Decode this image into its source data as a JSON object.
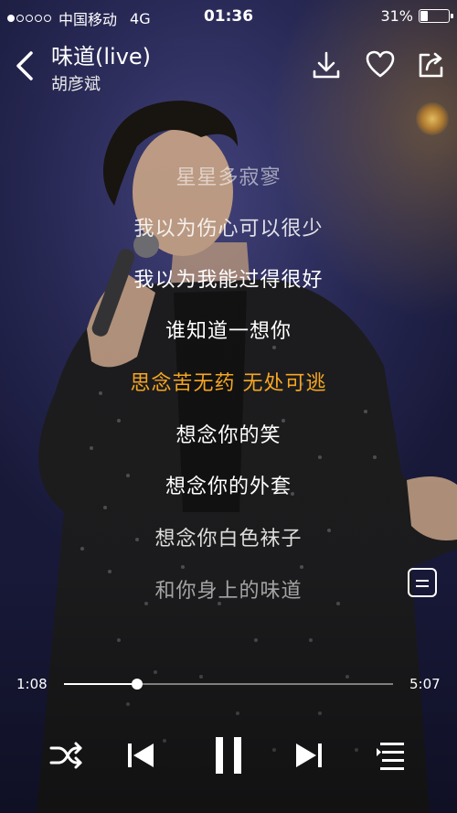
{
  "status_bar": {
    "carrier": "中国移动",
    "network": "4G",
    "time": "01:36",
    "battery_text": "31%",
    "battery_level": 0.31,
    "signal_dots_filled": 1,
    "signal_dots_total": 5
  },
  "header": {
    "title": "味道(live)",
    "artist": "胡彦斌"
  },
  "lyrics": {
    "lines": [
      "星星多寂寥",
      "我以为伤心可以很少",
      "我以为我能过得很好",
      "谁知道一想你",
      "思念苦无药 无处可逃",
      "想念你的笑",
      "想念你的外套",
      "想念你白色袜子",
      "和你身上的味道"
    ],
    "current_index": 4,
    "highlight_color": "#f5a623"
  },
  "progress": {
    "current": "1:08",
    "total": "5:07",
    "fraction": 0.2215
  },
  "icons": {
    "back": "back-chevron-icon",
    "download": "download-icon",
    "favorite": "heart-icon",
    "share": "share-icon",
    "lyrics_mode": "lyrics-doc-icon",
    "shuffle": "shuffle-icon",
    "previous": "previous-track-icon",
    "pause": "pause-icon",
    "next": "next-track-icon",
    "playlist": "playlist-icon"
  }
}
